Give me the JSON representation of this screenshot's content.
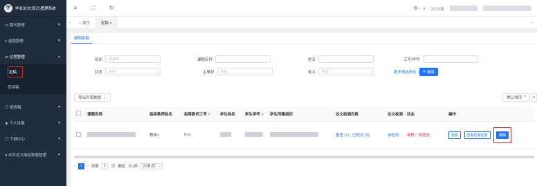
{
  "brand": {
    "logo": "学",
    "title": "毕业论文(设计)管理系统"
  },
  "sidebar": {
    "items": [
      {
        "label": "▭ 期刊管理",
        "icon": "folder-icon"
      },
      {
        "label": "≡ 选题管理",
        "icon": "list-icon"
      },
      {
        "label": "▭ 过程管理",
        "icon": "folder-icon",
        "open": true
      },
      {
        "label": "◎ 提终稿",
        "icon": "circle-icon"
      },
      {
        "label": "♟ 个人设置",
        "icon": "user-icon"
      },
      {
        "label": "◎ 下载中心",
        "icon": "download-icon"
      },
      {
        "label": "● 本科论文抽检数据管理",
        "icon": "data-icon"
      }
    ],
    "sub": [
      {
        "label": "定稿"
      },
      {
        "label": "答辩稿"
      }
    ]
  },
  "topbar": {
    "menu_icon": "≡",
    "expand_icon": "⛶",
    "refresh_icon": "↻",
    "year": "2025届",
    "mail_icon": "✉",
    "download_icon": "⤓"
  },
  "tabs": [
    {
      "label": "⌂ 首页"
    },
    {
      "label": "定稿 ×"
    }
  ],
  "card_tab": "编辑定稿",
  "filters": {
    "org_label": "组织",
    "org_placeholder": "请选择",
    "topic_label": "课题名称",
    "name_label": "姓名",
    "id_label": "工号/学号",
    "status_label": "状态",
    "status_placeholder": "所有",
    "advisor_label": "主辅导",
    "advisor_placeholder": "所有",
    "batch_label": "批次",
    "batch_placeholder": "所有",
    "more_label": "更多筛选条件",
    "search_label": "搜索"
  },
  "toolbar": {
    "export_label": "导出列表数据",
    "sort_label": "默认排序",
    "cols_label": "≡"
  },
  "table": {
    "headers": [
      "课题名称",
      "指导教师姓名",
      "指导教师工号",
      "学生姓名",
      "学生学号",
      "学生所属组织",
      "论文检测次数",
      "论文检测",
      "状态",
      "操作"
    ],
    "rows": [
      {
        "advisor_name": "教研1",
        "advisor_id": "tcs1",
        "check_counts": "重查 (1) ; 已提交 (0)",
        "check_result": "未检测",
        "status": "审核：待提交",
        "op_view": "查看",
        "op_records": "查看检测记录",
        "op_edit": "编辑"
      }
    ]
  },
  "pager": {
    "current": "1",
    "goto_label": "到第",
    "goto_value": "1",
    "page_unit": "页",
    "confirm": "确定",
    "total": "共1条",
    "page_size": "20条/页"
  },
  "colors": {
    "accent": "#1e74ff",
    "sidebar_bg": "#1f2d3d",
    "highlight": "#e0272a"
  }
}
